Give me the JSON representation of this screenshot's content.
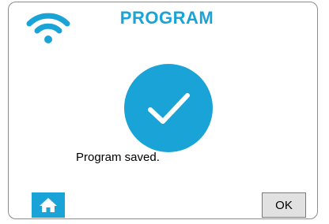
{
  "header": {
    "title": "PROGRAM",
    "wifi_icon": "wifi-icon"
  },
  "status": {
    "icon": "checkmark-circle-icon",
    "message": "Program saved."
  },
  "footer": {
    "home_icon": "home-icon",
    "ok_label": "OK"
  },
  "colors": {
    "accent": "#1aa3d6",
    "frame_border": "#8c8c8c",
    "button_bg": "#e1e1e1"
  }
}
